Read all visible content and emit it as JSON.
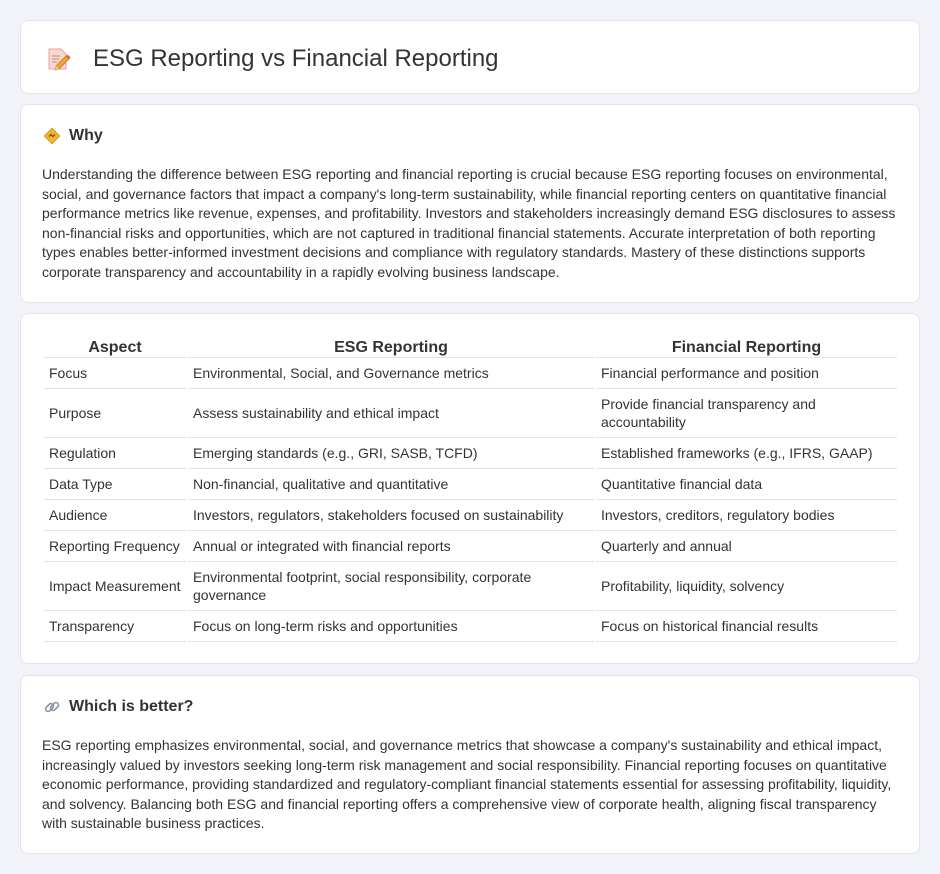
{
  "header": {
    "title": "ESG Reporting vs Financial Reporting",
    "icon": "pencil-note-icon"
  },
  "why": {
    "icon": "diamond-sign-icon",
    "title": "Why",
    "body": "Understanding the difference between ESG reporting and financial reporting is crucial because ESG reporting focuses on environmental, social, and governance factors that impact a company's long-term sustainability, while financial reporting centers on quantitative financial performance metrics like revenue, expenses, and profitability. Investors and stakeholders increasingly demand ESG disclosures to assess non-financial risks and opportunities, which are not captured in traditional financial statements. Accurate interpretation of both reporting types enables better-informed investment decisions and compliance with regulatory standards. Mastery of these distinctions supports corporate transparency and accountability in a rapidly evolving business landscape."
  },
  "comparison": {
    "headers": [
      "Aspect",
      "ESG Reporting",
      "Financial Reporting"
    ],
    "rows": [
      [
        "Focus",
        "Environmental, Social, and Governance metrics",
        "Financial performance and position"
      ],
      [
        "Purpose",
        "Assess sustainability and ethical impact",
        "Provide financial transparency and accountability"
      ],
      [
        "Regulation",
        "Emerging standards (e.g., GRI, SASB, TCFD)",
        "Established frameworks (e.g., IFRS, GAAP)"
      ],
      [
        "Data Type",
        "Non-financial, qualitative and quantitative",
        "Quantitative financial data"
      ],
      [
        "Audience",
        "Investors, regulators, stakeholders focused on sustainability",
        "Investors, creditors, regulatory bodies"
      ],
      [
        "Reporting Frequency",
        "Annual or integrated with financial reports",
        "Quarterly and annual"
      ],
      [
        "Impact Measurement",
        "Environmental footprint, social responsibility, corporate governance",
        "Profitability, liquidity, solvency"
      ],
      [
        "Transparency",
        "Focus on long-term risks and opportunities",
        "Focus on historical financial results"
      ]
    ]
  },
  "better": {
    "icon": "link-icon",
    "title": "Which is better?",
    "body": "ESG reporting emphasizes environmental, social, and governance metrics that showcase a company's sustainability and ethical impact, increasingly valued by investors seeking long-term risk management and social responsibility. Financial reporting focuses on quantitative economic performance, providing standardized and regulatory-compliant financial statements essential for assessing profitability, liquidity, and solvency. Balancing both ESG and financial reporting offers a comprehensive view of corporate health, aligning fiscal transparency with sustainable business practices."
  }
}
